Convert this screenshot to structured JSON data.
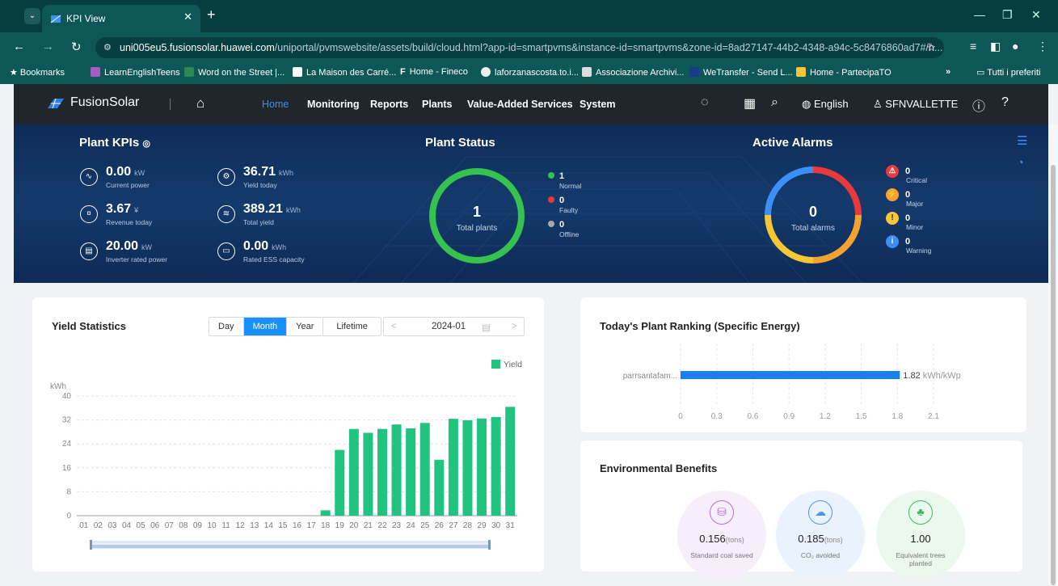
{
  "browser": {
    "tab_title": "KPI View",
    "url_host": "uni005eu5.fusionsolar.huawei.com",
    "url_path": "/uniportal/pvmswebsite/assets/build/cloud.html?app-id=smartpvms&instance-id=smartpvms&zone-id=8ad27147-44b2-4348-a94c-5c8476860ad7#/h...",
    "bookmarks": [
      "Bookmarks",
      "LearnEnglishTeens",
      "Word on the Street |...",
      "La Maison des Carré...",
      "Home - Fineco",
      "laforzanascosta.to.i...",
      "Associazione Archivi...",
      "WeTransfer - Send L...",
      "Home - PartecipaTO"
    ],
    "all_bookmarks": "Tutti i preferiti",
    "more": "»"
  },
  "header": {
    "logo": "FusionSolar",
    "menu": [
      "Home",
      "Monitoring",
      "Reports",
      "Plants",
      "Value-Added Services",
      "System"
    ],
    "language": "English",
    "user": "SFNVALLETTE"
  },
  "kpis": {
    "title": "Plant KPIs",
    "items": [
      {
        "value": "0.00",
        "unit": "kW",
        "label": "Current power",
        "icon": "power-icon"
      },
      {
        "value": "36.71",
        "unit": "kWh",
        "label": "Yield today",
        "icon": "yield-icon"
      },
      {
        "value": "3.67",
        "unit": "¥",
        "label": "Revenue today",
        "icon": "revenue-icon"
      },
      {
        "value": "389.21",
        "unit": "kWh",
        "label": "Total yield",
        "icon": "total-yield-icon"
      },
      {
        "value": "20.00",
        "unit": "kW",
        "label": "Inverter rated power",
        "icon": "inverter-icon"
      },
      {
        "value": "0.00",
        "unit": "kWh",
        "label": "Rated ESS capacity",
        "icon": "battery-icon"
      }
    ]
  },
  "plant_status": {
    "title": "Plant Status",
    "total": "1",
    "total_label": "Total plants",
    "legend": [
      {
        "count": "1",
        "label": "Normal",
        "color": "#35c24e"
      },
      {
        "count": "0",
        "label": "Faulty",
        "color": "#e8393c"
      },
      {
        "count": "0",
        "label": "Offline",
        "color": "#a8a8a8"
      }
    ]
  },
  "alarms": {
    "title": "Active Alarms",
    "total": "0",
    "total_label": "Total alarms",
    "items": [
      {
        "count": "0",
        "label": "Critical",
        "color": "#e8393c",
        "glyph": "⚠"
      },
      {
        "count": "0",
        "label": "Major",
        "color": "#f4a230",
        "glyph": "⚡"
      },
      {
        "count": "0",
        "label": "Minor",
        "color": "#f6c634",
        "glyph": "!"
      },
      {
        "count": "0",
        "label": "Warning",
        "color": "#3b8ff7",
        "glyph": "i"
      }
    ]
  },
  "yield": {
    "title": "Yield Statistics",
    "periods": [
      "Day",
      "Month",
      "Year",
      "Lifetime"
    ],
    "active_period": "Month",
    "date": "2024-01",
    "prev": "<",
    "next": ">"
  },
  "ranking": {
    "title": "Today's Plant Ranking (Specific Energy)",
    "plant": "parrsantafam...",
    "value": "1.82",
    "unit": "kWh/kWp",
    "ticks": [
      "0",
      "0.3",
      "0.6",
      "0.9",
      "1.2",
      "1.5",
      "1.8",
      "2.1"
    ]
  },
  "environment": {
    "title": "Environmental Benefits",
    "items": [
      {
        "value": "0.156",
        "unit": "(tons)",
        "label": "Standard coal saved"
      },
      {
        "value": "0.185",
        "unit": "(tons)",
        "label": "CO₂ avoided"
      },
      {
        "value": "1.00",
        "unit": "",
        "label": "Equivalent trees planted"
      }
    ]
  },
  "chart_data": {
    "type": "bar",
    "ylabel": "kWh",
    "ylim": [
      0,
      40
    ],
    "yticks": [
      "0",
      "8",
      "16",
      "24",
      "32",
      "40"
    ],
    "categories": [
      "01",
      "02",
      "03",
      "04",
      "05",
      "06",
      "07",
      "08",
      "09",
      "10",
      "11",
      "12",
      "13",
      "14",
      "15",
      "16",
      "17",
      "18",
      "19",
      "20",
      "21",
      "22",
      "23",
      "24",
      "25",
      "26",
      "27",
      "28",
      "29",
      "30",
      "31"
    ],
    "series": [
      {
        "name": "Yield",
        "color": "#21c47e",
        "values": [
          0,
          0,
          0,
          0,
          0,
          0,
          0,
          0,
          0,
          0,
          0,
          0,
          0,
          0,
          0,
          0,
          0,
          1.8,
          22,
          29,
          27.7,
          29,
          30.5,
          29.2,
          31,
          18.7,
          32.4,
          31.9,
          32.5,
          33,
          36.4
        ]
      }
    ],
    "legend": "top-right",
    "grid": true
  }
}
